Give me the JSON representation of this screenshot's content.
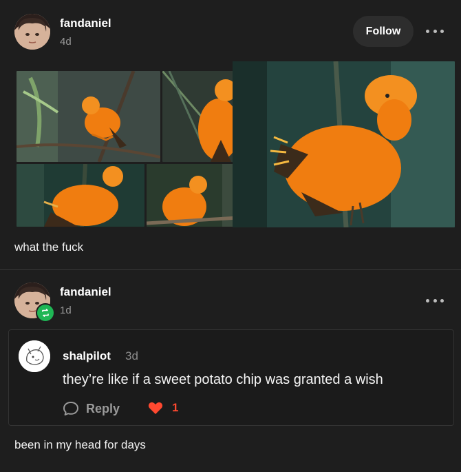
{
  "post": {
    "username": "fandaniel",
    "time_ago": "4d",
    "follow_label": "Follow",
    "caption": "what the fuck",
    "images": [
      {
        "alt_icon": "orange-bird-on-branch"
      },
      {
        "alt_icon": "orange-bird-closeup"
      },
      {
        "alt_icon": "orange-bird-side"
      },
      {
        "alt_icon": "orange-bird-perched"
      },
      {
        "alt_icon": "orange-bird-large"
      }
    ]
  },
  "reblog": {
    "username": "fandaniel",
    "time_ago": "1d",
    "caption": "been in my head for days"
  },
  "reply": {
    "username": "shalpilot",
    "time_ago": "3d",
    "text": "they’re like if a sweet potato chip was granted a wish",
    "reply_label": "Reply",
    "like_count": "1"
  },
  "colors": {
    "background": "#1e1e1e",
    "reblog_green": "#1fb655",
    "like_red": "#ff4930",
    "bird_orange": "#f07d10"
  }
}
